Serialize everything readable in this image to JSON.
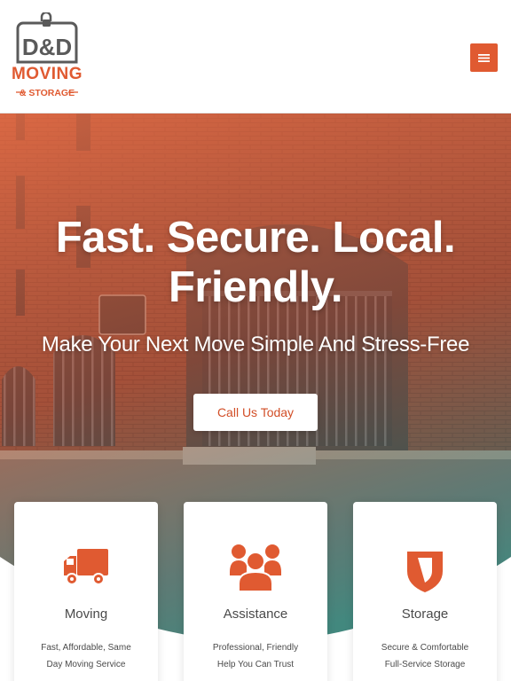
{
  "header": {
    "logo": {
      "monogram": "D&D",
      "wordmark": "MOVING",
      "tagline": "& STORAGE"
    },
    "menu_icon": "hamburger-icon"
  },
  "hero": {
    "headline_line1": "Fast. Secure. Local.",
    "headline_line2": "Friendly.",
    "subheadline": "Make Your Next Move Simple And Stress-Free",
    "cta_label": "Call Us Today"
  },
  "services": [
    {
      "icon": "moving-truck-icon",
      "title": "Moving",
      "description": "Fast, Affordable, Same Day Moving Service"
    },
    {
      "icon": "people-group-icon",
      "title": "Assistance",
      "description": "Professional, Friendly Help You Can Trust"
    },
    {
      "icon": "shield-icon",
      "title": "Storage",
      "description": "Secure & Comfortable Full-Service Storage"
    }
  ],
  "colors": {
    "accent": "#e05a31",
    "overlay_top": "#e46a45",
    "overlay_bottom": "#2f7a78",
    "card_text": "#4a4a4a"
  }
}
